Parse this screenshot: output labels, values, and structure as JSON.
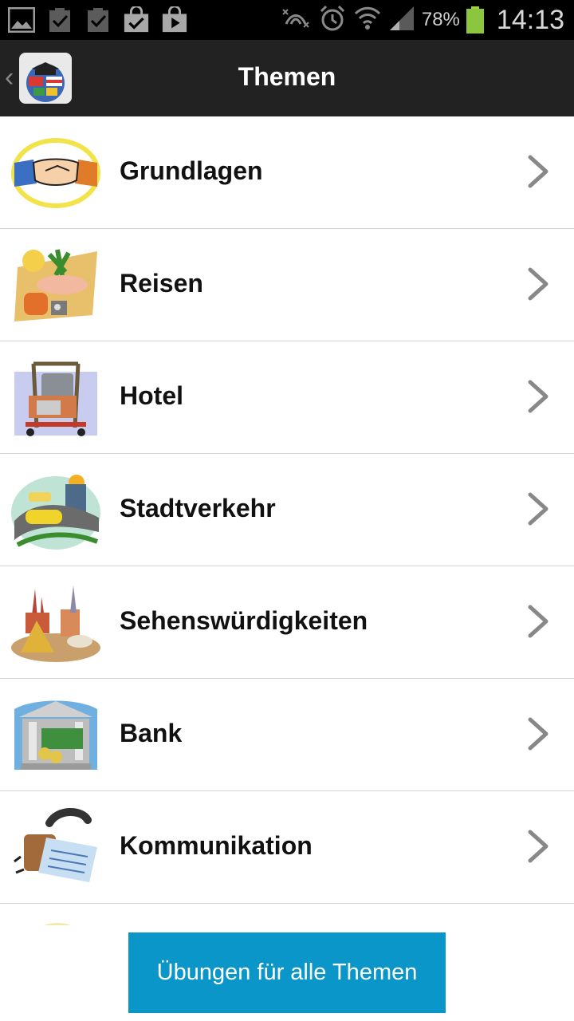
{
  "status_bar": {
    "left_icons": [
      "gallery-icon",
      "check-clipboard-icon",
      "check-clipboard-icon",
      "shopping-bag-check-icon",
      "play-store-icon"
    ],
    "right_icons": [
      "nfc-icon",
      "alarm-icon",
      "wifi-icon",
      "signal-icon"
    ],
    "battery_percent": "78%",
    "time": "14:13",
    "battery_color": "#8cc63f"
  },
  "action_bar": {
    "title": "Themen",
    "back_symbol": "‹",
    "background": "#222222"
  },
  "topics": [
    {
      "label": "Grundlagen",
      "icon": "handshake-icon"
    },
    {
      "label": "Reisen",
      "icon": "travel-icon"
    },
    {
      "label": "Hotel",
      "icon": "luggage-cart-icon"
    },
    {
      "label": "Stadtverkehr",
      "icon": "city-traffic-icon"
    },
    {
      "label": "Sehenswürdigkeiten",
      "icon": "landmarks-icon"
    },
    {
      "label": "Bank",
      "icon": "bank-icon"
    },
    {
      "label": "Kommunikation",
      "icon": "telephone-icon"
    }
  ],
  "cta": {
    "label": "Übungen für alle Themen",
    "color": "#0a96c8"
  }
}
